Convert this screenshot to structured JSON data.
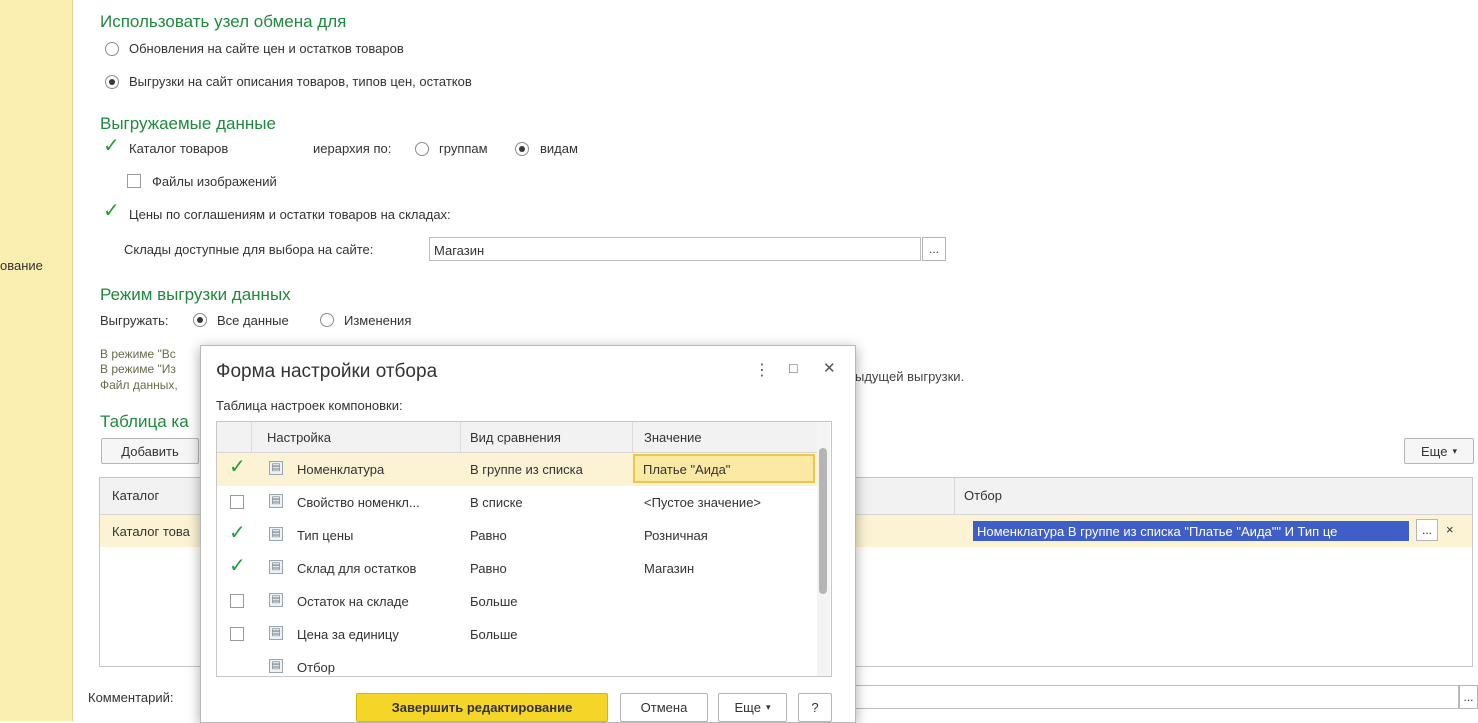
{
  "sidebar": {
    "label": "ование"
  },
  "exchange_node": {
    "title": "Использовать узел обмена для",
    "options": [
      {
        "label": "Обновления на сайте цен и остатков товаров",
        "selected": false
      },
      {
        "label": "Выгрузки на сайт описания товаров, типов цен, остатков",
        "selected": true
      }
    ]
  },
  "exported_data": {
    "title": "Выгружаемые данные",
    "catalog_label": "Каталог товаров",
    "catalog_checked": true,
    "hierarchy_label": "иерархия по:",
    "hierarchy_groups": "группам",
    "hierarchy_kinds": "видам",
    "hierarchy_selected": "видам",
    "images_label": "Файлы изображений",
    "images_checked": false,
    "prices_label": "Цены по соглашениям и остатки товаров на складах:",
    "prices_checked": true,
    "warehouses_label": "Склады доступные для выбора на сайте:",
    "warehouses_value": "Магазин",
    "dots": "..."
  },
  "export_mode": {
    "title": "Режим выгрузки данных",
    "label": "Выгружать:",
    "all_data": "Все данные",
    "changes": "Изменения",
    "selected": "Все данные",
    "hint1": "В режиме \"Вс",
    "hint2": "В режиме \"Из",
    "hint2_tail": "ыдущей выгрузки.",
    "hint3": "Файл данных,"
  },
  "catalog_table": {
    "title": "Таблица ка",
    "add_button": "Добавить",
    "more_button": "Еще",
    "col_catalog": "Каталог",
    "col_filter": "Отбор",
    "row_catalog": "Каталог това",
    "row_filter": "Номенклатура В группе из списка \"Платье \"Аида\"\" И Тип це",
    "dots": "...",
    "clear": "×"
  },
  "comment": {
    "label": "Комментарий:",
    "dots": "..."
  },
  "dialog": {
    "title": "Форма настройки отбора",
    "menu_icon": "⋮",
    "maximize_icon": "□",
    "close_icon": "✕",
    "table_caption": "Таблица настроек компоновки:",
    "columns": [
      "Настройка",
      "Вид сравнения",
      "Значение"
    ],
    "rows": [
      {
        "checked": true,
        "setting": "Номенклатура",
        "comparison": "В группе из списка",
        "value": "Платье \"Аида\""
      },
      {
        "checked": false,
        "setting": "Свойство номенкл...",
        "comparison": "В списке",
        "value": "<Пустое значение>"
      },
      {
        "checked": true,
        "setting": "Тип цены",
        "comparison": "Равно",
        "value": "Розничная"
      },
      {
        "checked": true,
        "setting": "Склад для остатков",
        "comparison": "Равно",
        "value": "Магазин"
      },
      {
        "checked": false,
        "setting": "Остаток на складе",
        "comparison": "Больше",
        "value": ""
      },
      {
        "checked": false,
        "setting": "Цена за единицу",
        "comparison": "Больше",
        "value": ""
      },
      {
        "checked": null,
        "setting": "Отбор",
        "comparison": "",
        "value": ""
      }
    ],
    "finish_button": "Завершить редактирование",
    "cancel_button": "Отмена",
    "more_button": "Еще",
    "help_button": "?"
  }
}
